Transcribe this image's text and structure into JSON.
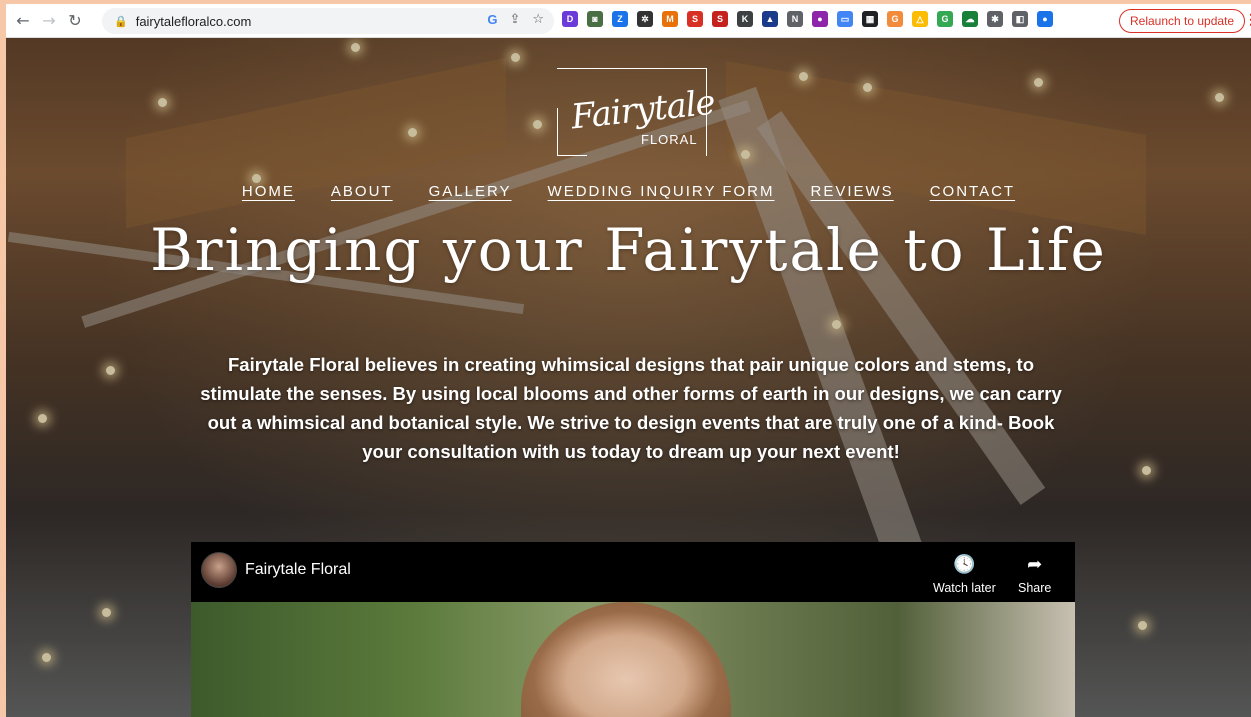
{
  "browser": {
    "url": "fairytalefloralco.com",
    "relaunch_label": "Relaunch to update",
    "extensions": [
      {
        "name": "d-ext-icon",
        "color": "#6a3bd8",
        "glyph": "D"
      },
      {
        "name": "image-ext-icon",
        "color": "#4b6f44",
        "glyph": "◙"
      },
      {
        "name": "z-ext-icon",
        "color": "#1a73e8",
        "glyph": "Z"
      },
      {
        "name": "gear-ext-icon",
        "color": "#333333",
        "glyph": "✲"
      },
      {
        "name": "m-ext-icon",
        "color": "#e8710a",
        "glyph": "M"
      },
      {
        "name": "s-ext-icon",
        "color": "#d93025",
        "glyph": "S"
      },
      {
        "name": "s-red-ext-icon",
        "color": "#c5221f",
        "glyph": "S"
      },
      {
        "name": "k-ext-icon",
        "color": "#3c4043",
        "glyph": "K"
      },
      {
        "name": "triangle-ext-icon",
        "color": "#1a3a8a",
        "glyph": "▲"
      },
      {
        "name": "n-ext-icon",
        "color": "#5f6368",
        "glyph": "N"
      },
      {
        "name": "circle-ext-icon",
        "color": "#8e24aa",
        "glyph": "●"
      },
      {
        "name": "screen-ext-icon",
        "color": "#4285f4",
        "glyph": "▭"
      },
      {
        "name": "qr-ext-icon",
        "color": "#202124",
        "glyph": "▦"
      },
      {
        "name": "g-orange-ext-icon",
        "color": "#f28b3c",
        "glyph": "G"
      },
      {
        "name": "drive-ext-icon",
        "color": "#fbbc04",
        "glyph": "△"
      },
      {
        "name": "g-green-ext-icon",
        "color": "#34a853",
        "glyph": "G"
      },
      {
        "name": "cloud-ext-icon",
        "color": "#188038",
        "glyph": "☁"
      },
      {
        "name": "puzzle-ext-icon",
        "color": "#5f6368",
        "glyph": "✱"
      },
      {
        "name": "sidepanel-icon",
        "color": "#5f6368",
        "glyph": "◧"
      },
      {
        "name": "profile-avatar",
        "color": "#1a73e8",
        "glyph": "●"
      }
    ]
  },
  "site": {
    "logo": {
      "script": "Fairytale",
      "sub": "FLORAL"
    },
    "nav": [
      "HOME",
      "ABOUT",
      "GALLERY",
      "WEDDING INQUIRY FORM",
      "REVIEWS",
      "CONTACT"
    ],
    "hero_title": "Bringing your Fairytale to Life",
    "hero_text": "Fairytale Floral believes in creating whimsical designs that pair unique colors and stems, to stimulate the senses. By using local blooms and other forms of earth in our designs, we can carry out a whimsical and botanical style. We strive to design events that are truly one of a kind- Book your consultation with us today to dream up your next event!",
    "video": {
      "channel": "Fairytale Floral",
      "watch_later": "Watch later",
      "share": "Share"
    }
  }
}
